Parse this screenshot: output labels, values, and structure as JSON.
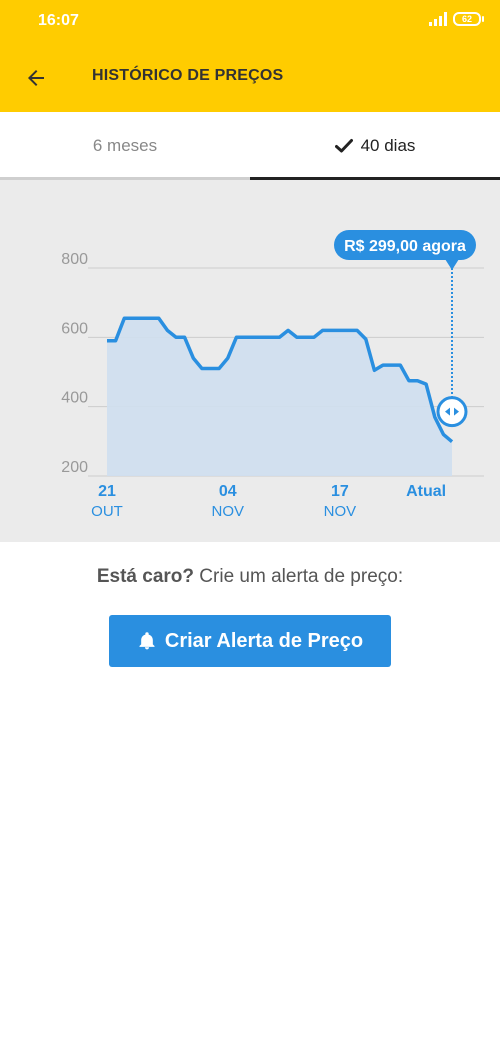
{
  "status_bar": {
    "time": "16:07",
    "battery": "62"
  },
  "header": {
    "title": "HISTÓRICO DE PREÇOS",
    "back_icon": "arrow-left-icon"
  },
  "tabs": [
    {
      "label": "6 meses",
      "selected": false
    },
    {
      "label": "40 dias",
      "selected": true
    }
  ],
  "colors": {
    "header": "#ffcc00",
    "accent": "#2a8fe0",
    "chart_bg": "#ebebeb"
  },
  "chart_data": {
    "type": "area",
    "ylim": [
      200,
      800
    ],
    "yticks": [
      "800",
      "600",
      "400",
      "200"
    ],
    "xlim": [
      0,
      40
    ],
    "x_ticks": [
      {
        "x": 0,
        "day": "21",
        "month": "OUT"
      },
      {
        "x": 14,
        "day": "04",
        "month": "NOV"
      },
      {
        "x": 27,
        "day": "17",
        "month": "NOV"
      },
      {
        "x": 37,
        "day": "Atual",
        "month": ""
      }
    ],
    "series": [
      {
        "x": [
          0,
          1,
          2,
          3,
          4,
          5,
          6,
          7,
          8,
          9,
          10,
          11,
          12,
          13,
          14,
          15,
          16,
          17,
          18,
          19,
          20,
          21,
          22,
          23,
          24,
          25,
          26,
          27,
          28,
          29,
          30,
          31,
          32,
          33,
          34,
          35,
          36,
          37,
          38,
          39,
          40
        ],
        "values": [
          590,
          590,
          655,
          655,
          655,
          655,
          655,
          620,
          600,
          600,
          540,
          510,
          510,
          510,
          540,
          600,
          600,
          600,
          600,
          600,
          600,
          620,
          600,
          600,
          600,
          620,
          620,
          620,
          620,
          620,
          595,
          505,
          520,
          520,
          520,
          475,
          475,
          465,
          370,
          320,
          299
        ]
      }
    ],
    "current": {
      "label": "R$ 299,00 agora",
      "value": 299
    },
    "grid": true
  },
  "alert": {
    "question": "Está caro?",
    "text": "Crie um alerta de preço:",
    "button_label": "Criar Alerta de Preço"
  }
}
